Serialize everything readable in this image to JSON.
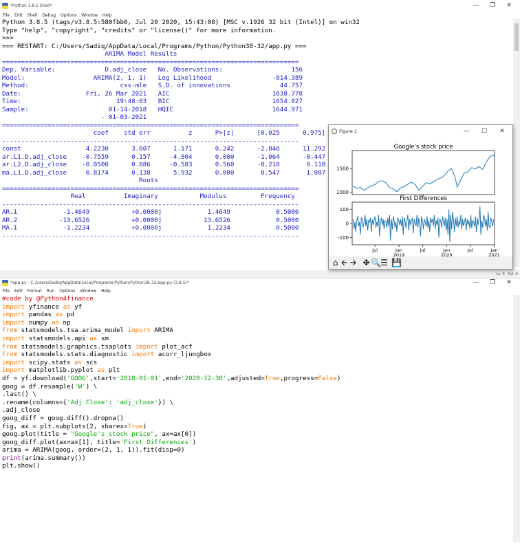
{
  "shell": {
    "title": "*Python 3.8.5 Shell*",
    "menu": [
      "File",
      "Edit",
      "Shell",
      "Debug",
      "Options",
      "Window",
      "Help"
    ],
    "lines": [
      {
        "c": "black",
        "t": "Python 3.8.5 (tags/v3.8.5:580fbb0, Jul 20 2020, 15:43:08) [MSC v.1926 32 bit (Intel)] on win32"
      },
      {
        "c": "black",
        "t": "Type \"help\", \"copyright\", \"credits\" or \"license()\" for more information."
      },
      {
        "c": "black",
        "t": ">>> "
      },
      {
        "c": "black",
        "t": "=== RESTART: C:/Users/Sadiq/AppData/Local/Programs/Python/Python38-32/app.py ==="
      },
      {
        "c": "blue",
        "t": "                           ARIMA Model Results                              "
      },
      {
        "c": "blue",
        "t": "=============================================================================="
      },
      {
        "c": "blue",
        "t": "Dep. Variable:             D.adj_close   No. Observations:                  156"
      },
      {
        "c": "blue",
        "t": "Model:                  ARIMA(2, 1, 1)   Log Likelihood                -814.389"
      },
      {
        "c": "blue",
        "t": "Method:                        css-mle   S.D. of innovations             44.757"
      },
      {
        "c": "blue",
        "t": "Date:                 Fri, 26 Mar 2021   AIC                           1638.778"
      },
      {
        "c": "blue",
        "t": "Time:                         19:48:03   BIC                           1654.027"
      },
      {
        "c": "blue",
        "t": "Sample:                     01-14-2018   HQIC                          1644.971"
      },
      {
        "c": "blue",
        "t": "                          - 01-03-2021                                       "
      },
      {
        "c": "blue",
        "t": "=============================================================================="
      },
      {
        "c": "blue",
        "t": "                        coef    std err          z      P>|z|      [0.025      0.975]"
      },
      {
        "c": "blue",
        "t": "------------------------------------------------------------------------------"
      },
      {
        "c": "blue",
        "t": "const                 4.2230      3.607      1.171      0.242      -2.846      11.292"
      },
      {
        "c": "blue",
        "t": "ar.L1.D.adj_close    -0.7559      0.157     -4.804      0.000      -1.064      -0.447"
      },
      {
        "c": "blue",
        "t": "ar.L2.D.adj_close    -0.0500      0.086     -0.583      0.560      -0.218       0.118"
      },
      {
        "c": "blue",
        "t": "ma.L1.D.adj_close     0.8174      0.138      5.932      0.000       0.547       1.087"
      },
      {
        "c": "blue",
        "t": "                                    Roots                                    "
      },
      {
        "c": "blue",
        "t": "=============================================================================="
      },
      {
        "c": "blue",
        "t": "                  Real          Imaginary           Modulus         Frequency"
      },
      {
        "c": "blue",
        "t": "------------------------------------------------------------------------------"
      },
      {
        "c": "blue",
        "t": "AR.1            -1.4649           +0.0000j            1.4649            0.5000"
      },
      {
        "c": "blue",
        "t": "AR.2           -13.6526           +0.0000j           13.6526            0.5000"
      },
      {
        "c": "blue",
        "t": "MA.1            -1.2234           +0.0000j            1.2234            0.5000"
      },
      {
        "c": "blue",
        "t": "------------------------------------------------------------------------------"
      }
    ],
    "status": {
      "ln": "Ln: 5",
      "col": "Col: 0"
    }
  },
  "figure": {
    "title": "Figure 1",
    "toolbar_icons": [
      "home-icon",
      "back-arrow-icon",
      "forward-arrow-icon",
      "pan-icon",
      "zoom-icon",
      "configure-icon",
      "save-icon"
    ]
  },
  "chart_data": [
    {
      "type": "line",
      "title": "Google's stock price",
      "xlabel": "",
      "ylabel": "",
      "ylim": [
        950,
        1880
      ],
      "yticks": [
        1000,
        1500
      ],
      "x_range": [
        "2018-01-07",
        "2021-01-03"
      ],
      "grid": false,
      "series": [
        {
          "color": "#1f77b4",
          "x": [
            "2018-01-14",
            "2018-02-11",
            "2018-03-11",
            "2018-04-08",
            "2018-05-06",
            "2018-06-03",
            "2018-07-01",
            "2018-07-29",
            "2018-08-26",
            "2018-09-23",
            "2018-10-21",
            "2018-11-18",
            "2018-12-16",
            "2019-01-13",
            "2019-02-10",
            "2019-03-10",
            "2019-04-07",
            "2019-05-05",
            "2019-06-02",
            "2019-06-30",
            "2019-07-28",
            "2019-08-25",
            "2019-09-22",
            "2019-10-20",
            "2019-11-17",
            "2019-12-15",
            "2020-01-12",
            "2020-02-09",
            "2020-03-08",
            "2020-03-22",
            "2020-04-19",
            "2020-05-17",
            "2020-06-14",
            "2020-07-12",
            "2020-08-09",
            "2020-09-06",
            "2020-10-04",
            "2020-11-01",
            "2020-11-29",
            "2020-12-27",
            "2021-01-03"
          ],
          "values": [
            1130,
            1080,
            1100,
            1040,
            1090,
            1140,
            1160,
            1230,
            1240,
            1200,
            1100,
            1070,
            1010,
            1090,
            1120,
            1170,
            1210,
            1160,
            1040,
            1120,
            1200,
            1180,
            1220,
            1270,
            1300,
            1350,
            1450,
            1500,
            1300,
            1110,
            1260,
            1410,
            1430,
            1520,
            1490,
            1540,
            1480,
            1640,
            1760,
            1780,
            1750
          ]
        }
      ]
    },
    {
      "type": "line",
      "title": "First Differences",
      "xlabel": "",
      "ylabel": "",
      "ylim": [
        -150,
        150
      ],
      "yticks": [
        -100,
        0,
        100
      ],
      "xticks": [
        {
          "x": "2018-07-01",
          "label": "Jul"
        },
        {
          "x": "2019-01-01",
          "label": "Jan",
          "sub": "2019"
        },
        {
          "x": "2019-07-01",
          "label": "Jul"
        },
        {
          "x": "2020-01-01",
          "label": "Jan",
          "sub": "2020"
        },
        {
          "x": "2020-07-01",
          "label": "Jul"
        },
        {
          "x": "2021-01-01",
          "label": "Jan",
          "sub": "2021"
        }
      ],
      "x_range": [
        "2018-01-07",
        "2021-01-03"
      ],
      "grid": false,
      "series": [
        {
          "color": "#1f77b4",
          "x_start": "2018-01-14",
          "x_step_days": 7,
          "values": [
            30,
            -40,
            10,
            -60,
            20,
            50,
            -20,
            10,
            -80,
            40,
            30,
            -30,
            10,
            60,
            -20,
            30,
            -50,
            20,
            10,
            40,
            -60,
            30,
            -10,
            20,
            50,
            -30,
            10,
            -20,
            60,
            -90,
            20,
            40,
            -10,
            30,
            -40,
            20,
            10,
            -30,
            40,
            -20,
            60,
            -120,
            30,
            -40,
            50,
            20,
            -30,
            10,
            -60,
            40,
            20,
            -10,
            30,
            -20,
            50,
            -80,
            40,
            10,
            -30,
            20,
            60,
            -50,
            30,
            -10,
            20,
            40,
            -70,
            30,
            10,
            -20,
            60,
            -30,
            40,
            -10,
            -90,
            50,
            20,
            -40,
            30,
            10,
            -20,
            50,
            -30,
            20,
            -60,
            40,
            10,
            30,
            -20,
            60,
            -40,
            20,
            -10,
            40,
            -100,
            30,
            20,
            -30,
            50,
            10,
            -20,
            40,
            -50,
            30,
            -80,
            100,
            -130,
            60,
            -40,
            80,
            30,
            -60,
            40,
            -20,
            50,
            -30,
            20,
            -10,
            60,
            -40,
            30,
            -20,
            10,
            40,
            -50,
            30,
            -10,
            20,
            -40,
            60,
            -30,
            20,
            10,
            -20,
            50,
            -60,
            40,
            -10,
            30,
            120,
            -80,
            20,
            -30,
            60,
            40,
            -20,
            30,
            -50,
            80,
            -20,
            -30,
            40,
            10,
            -20,
            30
          ]
        }
      ]
    }
  ],
  "editor": {
    "title": "*app.py - C:/Users/Sadiq/AppData/Local/Programs/Python/Python38-32/app.py (3.8.5)*",
    "menu": [
      "File",
      "Edit",
      "Format",
      "Run",
      "Options",
      "Window",
      "Help"
    ],
    "lines": [
      [
        {
          "k": "com",
          "t": "#code by @Python4finance"
        }
      ],
      [
        {
          "k": "kw",
          "t": "import"
        },
        {
          "k": "txt",
          "t": " yfinance "
        },
        {
          "k": "kw",
          "t": "as"
        },
        {
          "k": "txt",
          "t": " yf"
        }
      ],
      [
        {
          "k": "kw",
          "t": "import"
        },
        {
          "k": "txt",
          "t": " pandas "
        },
        {
          "k": "kw",
          "t": "as"
        },
        {
          "k": "txt",
          "t": " pd"
        }
      ],
      [
        {
          "k": "kw",
          "t": "import"
        },
        {
          "k": "txt",
          "t": " numpy "
        },
        {
          "k": "kw",
          "t": "as"
        },
        {
          "k": "txt",
          "t": " np"
        }
      ],
      [
        {
          "k": "kw",
          "t": "from"
        },
        {
          "k": "txt",
          "t": " statsmodels.tsa.arima_model "
        },
        {
          "k": "kw",
          "t": "import"
        },
        {
          "k": "txt",
          "t": " ARIMA"
        }
      ],
      [
        {
          "k": "kw",
          "t": "import"
        },
        {
          "k": "txt",
          "t": " statsmodels.api "
        },
        {
          "k": "kw",
          "t": "as"
        },
        {
          "k": "txt",
          "t": " sm"
        }
      ],
      [
        {
          "k": "kw",
          "t": "from"
        },
        {
          "k": "txt",
          "t": " statsmodels.graphics.tsaplots "
        },
        {
          "k": "kw",
          "t": "import"
        },
        {
          "k": "txt",
          "t": " plot_acf"
        }
      ],
      [
        {
          "k": "kw",
          "t": "from"
        },
        {
          "k": "txt",
          "t": " statsmodels.stats.diagnostic "
        },
        {
          "k": "kw",
          "t": "import"
        },
        {
          "k": "txt",
          "t": " acorr_ljungbox"
        }
      ],
      [
        {
          "k": "kw",
          "t": "import"
        },
        {
          "k": "txt",
          "t": " scipy.stats "
        },
        {
          "k": "kw",
          "t": "as"
        },
        {
          "k": "txt",
          "t": " scs"
        }
      ],
      [
        {
          "k": "kw",
          "t": "import"
        },
        {
          "k": "txt",
          "t": " matplotlib.pyplot "
        },
        {
          "k": "kw",
          "t": "as"
        },
        {
          "k": "txt",
          "t": " plt"
        }
      ],
      [
        {
          "k": "txt",
          "t": "df = yf.download("
        },
        {
          "k": "str",
          "t": "'GOOG'"
        },
        {
          "k": "txt",
          "t": ",start="
        },
        {
          "k": "str",
          "t": "'2018-01-01'"
        },
        {
          "k": "txt",
          "t": ",end="
        },
        {
          "k": "str",
          "t": "'2020-12-30'"
        },
        {
          "k": "txt",
          "t": ",adjusted="
        },
        {
          "k": "kw",
          "t": "True"
        },
        {
          "k": "txt",
          "t": ",progress="
        },
        {
          "k": "kw",
          "t": "False"
        },
        {
          "k": "txt",
          "t": ")"
        }
      ],
      [
        {
          "k": "txt",
          "t": "goog = df.resample("
        },
        {
          "k": "str",
          "t": "'W'"
        },
        {
          "k": "txt",
          "t": ") \\"
        }
      ],
      [
        {
          "k": "txt",
          "t": ".last() \\"
        }
      ],
      [
        {
          "k": "txt",
          "t": ".rename(columns={"
        },
        {
          "k": "str",
          "t": "'Adj Close'"
        },
        {
          "k": "txt",
          "t": ": "
        },
        {
          "k": "str",
          "t": "'adj_close'"
        },
        {
          "k": "txt",
          "t": "}) \\"
        }
      ],
      [
        {
          "k": "txt",
          "t": ".adj_close"
        }
      ],
      [
        {
          "k": "txt",
          "t": "goog_diff = goog.diff().dropna()"
        }
      ],
      [
        {
          "k": "txt",
          "t": "fig, ax = plt.subplots(2, sharex="
        },
        {
          "k": "kw",
          "t": "True"
        },
        {
          "k": "txt",
          "t": ")"
        }
      ],
      [
        {
          "k": "txt",
          "t": "goog.plot(title = "
        },
        {
          "k": "str",
          "t": "\"Google's stock price\""
        },
        {
          "k": "txt",
          "t": ", ax=ax[0])"
        }
      ],
      [
        {
          "k": "txt",
          "t": "goog_diff.plot(ax=ax[1], title="
        },
        {
          "k": "str",
          "t": "'First Differences'"
        },
        {
          "k": "txt",
          "t": ")"
        }
      ],
      [
        {
          "k": "txt",
          "t": "arima = ARIMA(goog, order=(2, 1, 1)).fit(disp=0)"
        }
      ],
      [
        {
          "k": "bi",
          "t": "print"
        },
        {
          "k": "txt",
          "t": "(arima.summary())"
        }
      ],
      [
        {
          "k": "txt",
          "t": "plt.show()"
        }
      ]
    ]
  }
}
